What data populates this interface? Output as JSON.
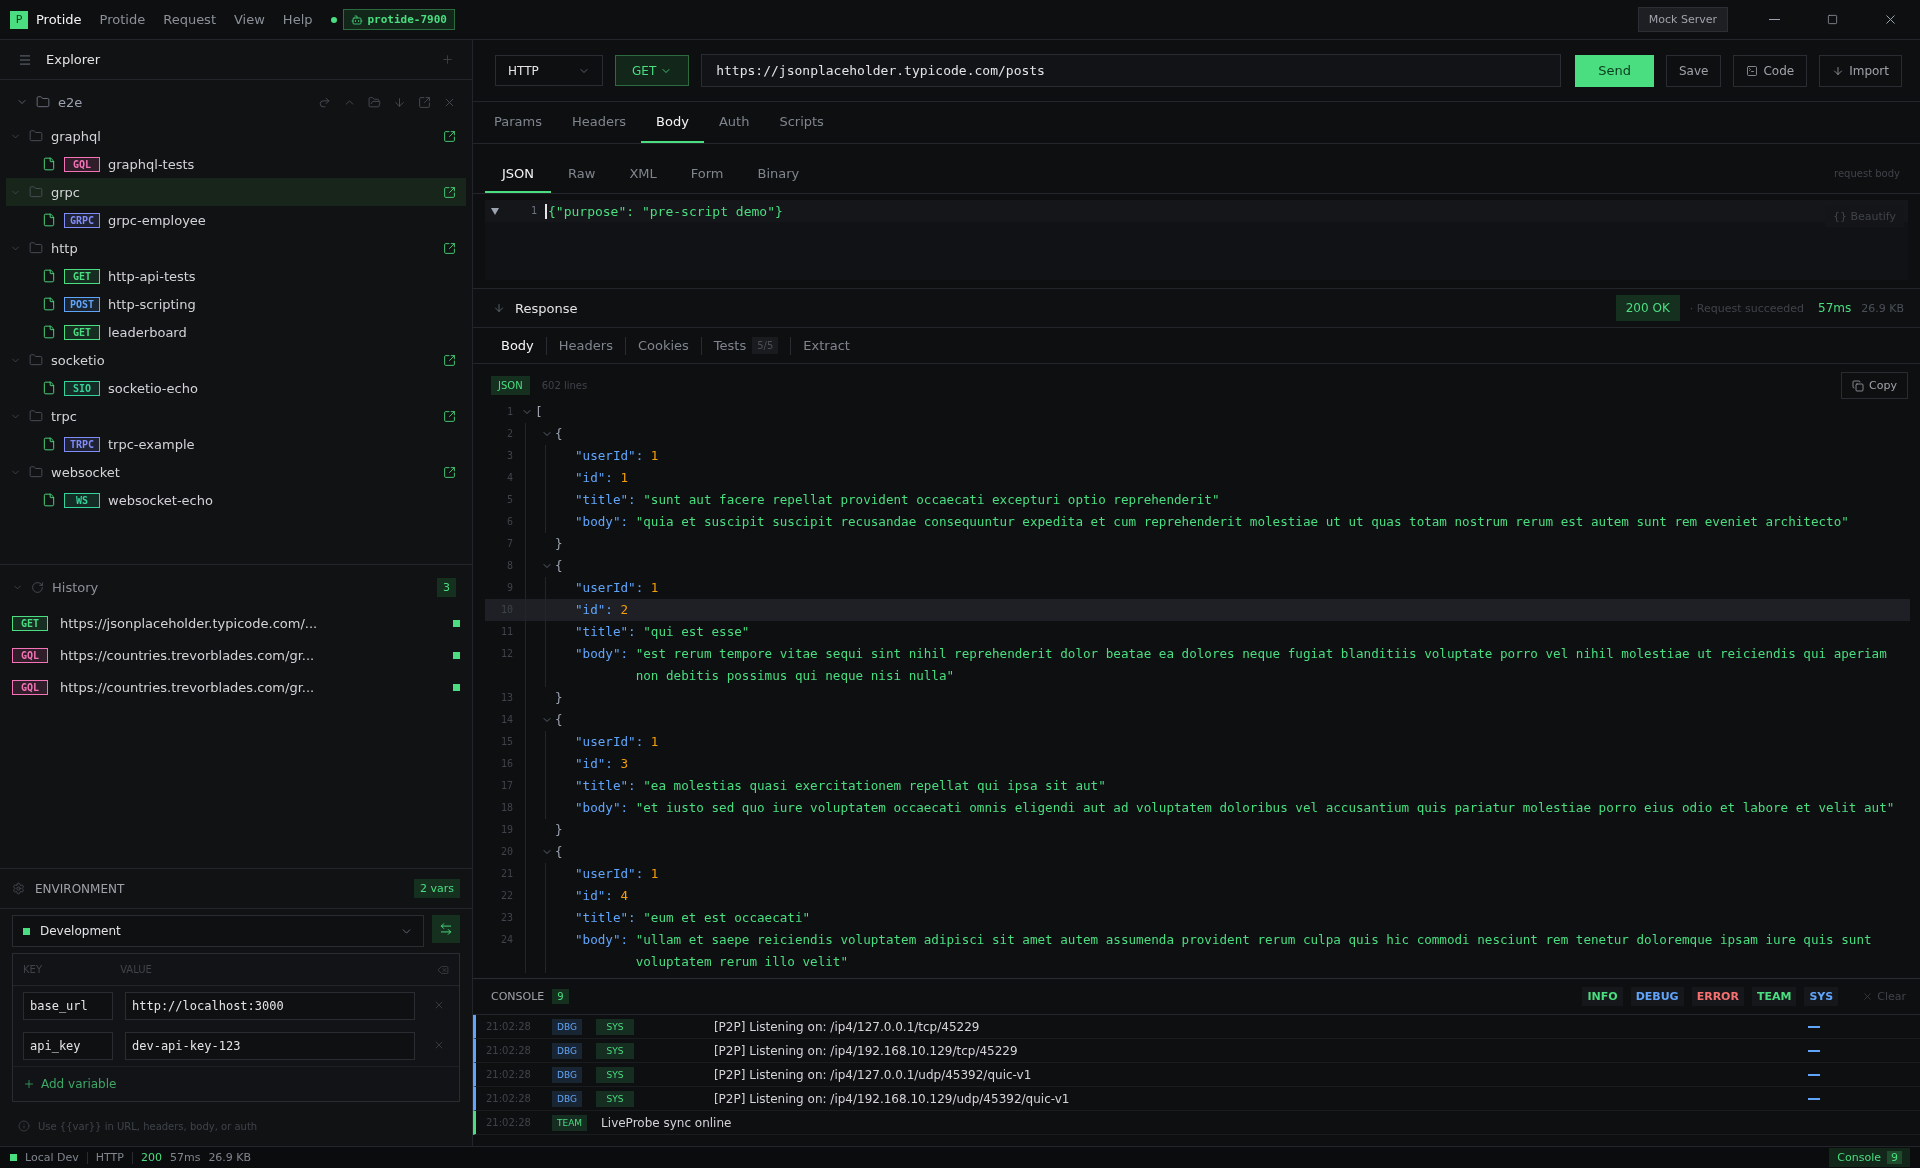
{
  "titlebar": {
    "logo": "P",
    "app_name": "Protide",
    "menus": [
      "Protide",
      "Request",
      "View",
      "Help"
    ],
    "instance": "protide-7900",
    "mock_server": "Mock Server"
  },
  "sidebar": {
    "title": "Explorer",
    "root": {
      "name": "e2e",
      "expanded": true
    },
    "folders": [
      {
        "name": "graphql",
        "expanded": true,
        "selected": false,
        "requests": [
          {
            "method": "GQL",
            "name": "graphql-tests",
            "color": "#f472b6"
          }
        ]
      },
      {
        "name": "grpc",
        "expanded": true,
        "selected": true,
        "requests": [
          {
            "method": "GRPC",
            "name": "grpc-employee",
            "color": "#818cf8"
          }
        ]
      },
      {
        "name": "http",
        "expanded": true,
        "selected": false,
        "requests": [
          {
            "method": "GET",
            "name": "http-api-tests",
            "color": "#4ade80"
          },
          {
            "method": "POST",
            "name": "http-scripting",
            "color": "#60a5fa"
          },
          {
            "method": "GET",
            "name": "leaderboard",
            "color": "#4ade80"
          }
        ]
      },
      {
        "name": "socketio",
        "expanded": true,
        "selected": false,
        "requests": [
          {
            "method": "SIO",
            "name": "socketio-echo",
            "color": "#34d399"
          }
        ]
      },
      {
        "name": "trpc",
        "expanded": true,
        "selected": false,
        "requests": [
          {
            "method": "TRPC",
            "name": "trpc-example",
            "color": "#818cf8"
          }
        ]
      },
      {
        "name": "websocket",
        "expanded": true,
        "selected": false,
        "requests": [
          {
            "method": "WS",
            "name": "websocket-echo",
            "color": "#34d399"
          }
        ]
      }
    ],
    "history": {
      "title": "History",
      "count": "3",
      "expanded": true,
      "items": [
        {
          "method": "GET",
          "url": "https://jsonplaceholder.typicode.com/...",
          "color": "#4ade80"
        },
        {
          "method": "GQL",
          "url": "https://countries.trevorblades.com/gr...",
          "color": "#f472b6"
        },
        {
          "method": "GQL",
          "url": "https://countries.trevorblades.com/gr...",
          "color": "#f472b6"
        }
      ]
    },
    "environment": {
      "title": "ENVIRONMENT",
      "count": "2 vars",
      "selected_env": "Development",
      "columns": [
        "KEY",
        "VALUE"
      ],
      "variables": [
        {
          "key": "base_url",
          "value": "http://localhost:3000"
        },
        {
          "key": "api_key",
          "value": "dev-api-key-123"
        }
      ],
      "add_label": "Add variable",
      "hint": "Use {{var}} in URL, headers, body, or auth"
    }
  },
  "request": {
    "protocol": "HTTP",
    "method": "GET",
    "url": "https://jsonplaceholder.typicode.com/posts",
    "actions": [
      "Send",
      "Save",
      "Code",
      "Import"
    ],
    "tabs": [
      {
        "label": "Params",
        "selected": false
      },
      {
        "label": "Headers",
        "selected": false
      },
      {
        "label": "Body",
        "selected": true
      },
      {
        "label": "Auth",
        "selected": false
      },
      {
        "label": "Scripts",
        "selected": false
      }
    ],
    "body_tabs": [
      {
        "label": "JSON",
        "selected": true
      },
      {
        "label": "Raw",
        "selected": false
      },
      {
        "label": "XML",
        "selected": false
      },
      {
        "label": "Form",
        "selected": false
      },
      {
        "label": "Binary",
        "selected": false
      }
    ],
    "body_hint": "request body",
    "beautify": "{} Beautify",
    "editor_lines": [
      {
        "number": "1",
        "text": "{\"purpose\": \"pre-script demo\"}"
      }
    ]
  },
  "response": {
    "title": "Response",
    "status": "200 OK",
    "message": "· Request succeeded",
    "time": "57ms",
    "size": "26.9 KB",
    "tabs": [
      {
        "label": "Body",
        "selected": true
      },
      {
        "label": "Headers",
        "selected": false
      },
      {
        "label": "Cookies",
        "selected": false
      },
      {
        "label": "Tests",
        "badge": "5/5",
        "selected": false
      },
      {
        "label": "Extract",
        "selected": false
      }
    ],
    "format": "JSON",
    "line_count": "602 lines",
    "copy": "Copy",
    "code": {
      "number": "1",
      "open": "[",
      "children": [
        {
          "number": "2",
          "open": "{",
          "close_number": "7",
          "close": "}",
          "children": [
            {
              "number": "3",
              "key": "\"userId\":",
              "value": "1",
              "kind": "number",
              "current": false
            },
            {
              "number": "4",
              "key": "\"id\":",
              "value": "1",
              "kind": "number",
              "current": false
            },
            {
              "number": "5",
              "key": "\"title\":",
              "value": "\"sunt aut facere repellat provident occaecati excepturi optio reprehenderit\"",
              "kind": "string",
              "current": false
            },
            {
              "number": "6",
              "key": "\"body\":",
              "value": "\"quia et suscipit suscipit recusandae consequuntur expedita et cum reprehenderit molestiae ut ut quas totam nostrum rerum est autem sunt rem eveniet architecto\"",
              "kind": "string",
              "current": false
            }
          ]
        },
        {
          "number": "8",
          "open": "{",
          "close_number": "13",
          "close": "}",
          "children": [
            {
              "number": "9",
              "key": "\"userId\":",
              "value": "1",
              "kind": "number",
              "current": false
            },
            {
              "number": "10",
              "key": "\"id\":",
              "value": "2",
              "kind": "number",
              "current": true
            },
            {
              "number": "11",
              "key": "\"title\":",
              "value": "\"qui est esse\"",
              "kind": "string",
              "current": false
            },
            {
              "number": "12",
              "key": "\"body\":",
              "value": "\"est rerum tempore vitae sequi sint nihil reprehenderit dolor beatae ea dolores neque fugiat blanditiis voluptate porro vel nihil molestiae ut reiciendis qui aperiam non debitis possimus qui neque nisi nulla\"",
              "kind": "string",
              "current": false
            }
          ]
        },
        {
          "number": "14",
          "open": "{",
          "close_number": "19",
          "close": "}",
          "children": [
            {
              "number": "15",
              "key": "\"userId\":",
              "value": "1",
              "kind": "number",
              "current": false
            },
            {
              "number": "16",
              "key": "\"id\":",
              "value": "3",
              "kind": "number",
              "current": false
            },
            {
              "number": "17",
              "key": "\"title\":",
              "value": "\"ea molestias quasi exercitationem repellat qui ipsa sit aut\"",
              "kind": "string",
              "current": false
            },
            {
              "number": "18",
              "key": "\"body\":",
              "value": "\"et iusto sed quo iure voluptatem occaecati omnis eligendi aut ad voluptatem doloribus vel accusantium quis pariatur molestiae porro eius odio et labore et velit aut\"",
              "kind": "string",
              "current": false
            }
          ]
        },
        {
          "number": "20",
          "open": "{",
          "children": [
            {
              "number": "21",
              "key": "\"userId\":",
              "value": "1",
              "kind": "number",
              "current": false
            },
            {
              "number": "22",
              "key": "\"id\":",
              "value": "4",
              "kind": "number",
              "current": false
            },
            {
              "number": "23",
              "key": "\"title\":",
              "value": "\"eum et est occaecati\"",
              "kind": "string",
              "current": false
            },
            {
              "number": "24",
              "key": "\"body\":",
              "value": "\"ullam et saepe reiciendis voluptatem adipisci sit amet autem assumenda provident rerum culpa quis hic commodi nesciunt rem tenetur doloremque ipsam iure quis sunt voluptatem rerum illo velit\"",
              "kind": "string",
              "current": false
            }
          ]
        }
      ]
    }
  },
  "console": {
    "title": "CONSOLE",
    "count": "9",
    "filters": [
      {
        "label": "INFO",
        "color": "#4ade80"
      },
      {
        "label": "DEBUG",
        "color": "#60a5fa"
      },
      {
        "label": "ERROR",
        "color": "#f87171"
      },
      {
        "label": "TEAM",
        "color": "#4ade80"
      },
      {
        "label": "SYS",
        "color": "#60a5fa"
      }
    ],
    "clear": "Clear",
    "rows": [
      {
        "time": "21:02:28",
        "level": "DBG",
        "source": "SYS",
        "message": "[P2P] Listening on: /ip4/127.0.0.1/tcp/45229",
        "color": "#60a5fa"
      },
      {
        "time": "21:02:28",
        "level": "DBG",
        "source": "SYS",
        "message": "[P2P] Listening on: /ip4/192.168.10.129/tcp/45229",
        "color": "#60a5fa"
      },
      {
        "time": "21:02:28",
        "level": "DBG",
        "source": "SYS",
        "message": "[P2P] Listening on: /ip4/127.0.0.1/udp/45392/quic-v1",
        "color": "#60a5fa"
      },
      {
        "time": "21:02:28",
        "level": "DBG",
        "source": "SYS",
        "message": "[P2P] Listening on: /ip4/192.168.10.129/udp/45392/quic-v1",
        "color": "#60a5fa"
      },
      {
        "time": "21:02:28",
        "level": "TEAM",
        "message": "LiveProbe sync online",
        "color": "#4ade80"
      }
    ]
  },
  "status_bar": {
    "env": "Local Dev",
    "protocol": "HTTP",
    "code": "200",
    "time": "57ms",
    "size": "26.9 KB",
    "console": "Console",
    "console_count": "9"
  }
}
